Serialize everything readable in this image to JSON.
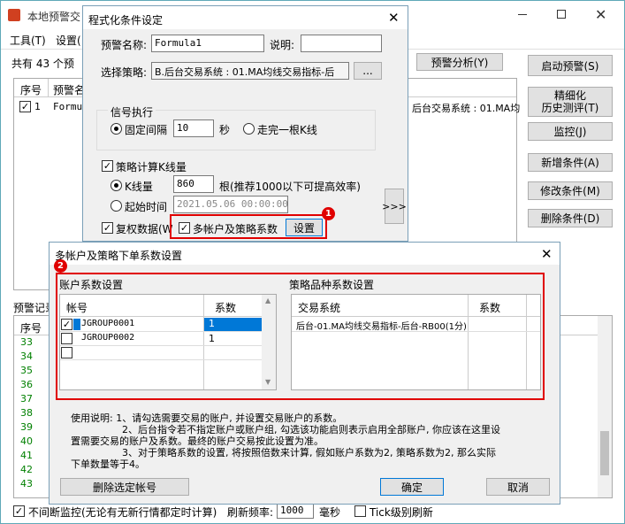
{
  "main": {
    "title": "本地预警交",
    "menu_tools": "工具(T)",
    "menu_settings": "设置(",
    "count_text": "共有 43 个预",
    "warn_analysis_btn": "预警分析(Y)",
    "table_headers": [
      "序号",
      "预警名"
    ],
    "row1_index": "1",
    "row1_name": "Formu",
    "row1_right": "后台交易系统 : 01.MA均",
    "buttons": {
      "start": "启动预警(S)",
      "refine1": "精细化",
      "refine2": "历史测评(T)",
      "monitor": "监控(J)",
      "add": "新增条件(A)",
      "modify": "修改条件(M)",
      "delete": "删除条件(D)"
    },
    "log_label": "预警记录",
    "log_header": "序号",
    "log_rows": [
      "33",
      "34",
      "35",
      "36",
      "37",
      "38",
      "39",
      "40",
      "41",
      "42",
      "43"
    ],
    "bottom_check": "不间断监控(无论有无新行情都定时计算)",
    "refresh_label": "刷新频率:",
    "refresh_value": "1000",
    "refresh_unit": "毫秒",
    "tick_label": "Tick级别刷新"
  },
  "cond_dialog": {
    "title": "程式化条件设定",
    "name_label": "预警名称:",
    "name_value": "Formula1",
    "desc_label": "说明:",
    "desc_value": "",
    "strategy_label": "选择策略:",
    "strategy_value": "B.后台交易系统 : 01.MA均线交易指标-后",
    "browse_btn": "...",
    "signal_group": "信号执行",
    "fixed_label": "固定间隔",
    "fixed_value": "10",
    "sec_unit": "秒",
    "bar_label": "走完一根K线",
    "calc_label": "策略计算K线量",
    "kline_label": "K线量",
    "kline_value": "860",
    "kline_hint": "根(推荐1000以下可提高效率)",
    "start_label": "起始时间",
    "start_value": "2021.05.06 00:00:00",
    "restore_label": "复权数据(W",
    "multi_label": "多帐户及策略系数",
    "setup_btn": "设置",
    "more_btn": ">>>",
    "badge1": "1"
  },
  "coef_dialog": {
    "title": "多帐户及策略下单系数设置",
    "badge2": "2",
    "acct_group": "账户系数设置",
    "acct_headers": [
      "帐号",
      "系数"
    ],
    "acct_rows": [
      {
        "name": "JGROUP0001",
        "coef": "1",
        "checked": true
      },
      {
        "name": "JGROUP0002",
        "coef": "1",
        "checked": false
      },
      {
        "name": "",
        "coef": "",
        "checked": false
      }
    ],
    "strat_group": "策略品种系数设置",
    "strat_headers": [
      "交易系统",
      "系数"
    ],
    "strat_row": "后台-01.MA均线交易指标-后台-RB00(1分)",
    "usage_1": "使用说明: 1、请勾选需要交易的账户, 并设置交易账户的系数。",
    "usage_2": "2、后台指令若不指定账户或账户组, 勾选该功能启则表示启用全部账户, 你应该在这里设",
    "usage_3": "置需要交易的账户及系数。最终的账户交易按此设置为准。",
    "usage_4": "3、对于策略系数的设置, 将按照倍数来计算, 假如账户系数为2, 策略系数为2, 那么实际",
    "usage_5": "下单数量等于4。",
    "delete_btn": "删除选定帐号",
    "ok_btn": "确定",
    "cancel_btn": "取消"
  },
  "colors": {
    "red": "#e00000",
    "green": "#008000",
    "select": "#0078d7"
  }
}
